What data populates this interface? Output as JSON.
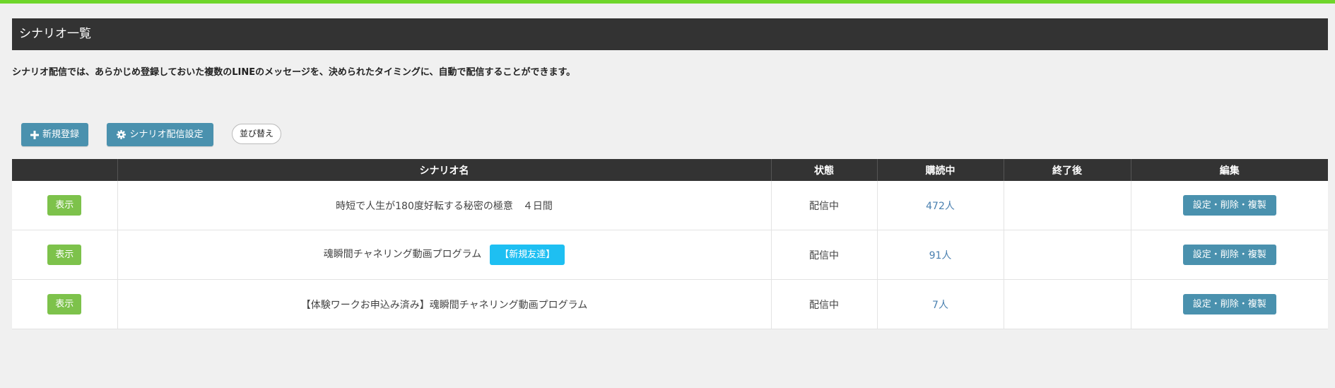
{
  "header": {
    "title": "シナリオ一覧"
  },
  "intro": {
    "text": "シナリオ配信では、あらかじめ登録しておいた複数のLINEのメッセージを、決められたタイミングに、自動で配信することができます。"
  },
  "toolbar": {
    "new_label": "新規登録",
    "new_icon": "plus-icon",
    "settings_label": "シナリオ配信設定",
    "settings_icon": "gear-icon",
    "sort_label": "並び替え"
  },
  "table": {
    "headers": [
      "",
      "シナリオ名",
      "状態",
      "購読中",
      "終了後",
      "編集"
    ],
    "rows": [
      {
        "show_label": "表示",
        "name": "時短で人生が180度好転する秘密の極意　４日間",
        "badge": "",
        "status": "配信中",
        "subscribers": "472人",
        "after": "",
        "edit_label": "設定・削除・複製"
      },
      {
        "show_label": "表示",
        "name": "魂瞬間チャネリング動画プログラム",
        "badge": "【新規友達】",
        "status": "配信中",
        "subscribers": "91人",
        "after": "",
        "edit_label": "設定・削除・複製"
      },
      {
        "show_label": "表示",
        "name": "【体験ワークお申込み済み】魂瞬間チャネリング動画プログラム",
        "badge": "",
        "status": "配信中",
        "subscribers": "7人",
        "after": "",
        "edit_label": "設定・削除・複製"
      }
    ]
  },
  "colors": {
    "top_bar": "#6fd62b",
    "header_bg": "#333333",
    "primary_button": "#4a91ae",
    "show_button": "#7dc24b",
    "badge_new": "#1ebff2",
    "count_link": "#4a80b0"
  }
}
